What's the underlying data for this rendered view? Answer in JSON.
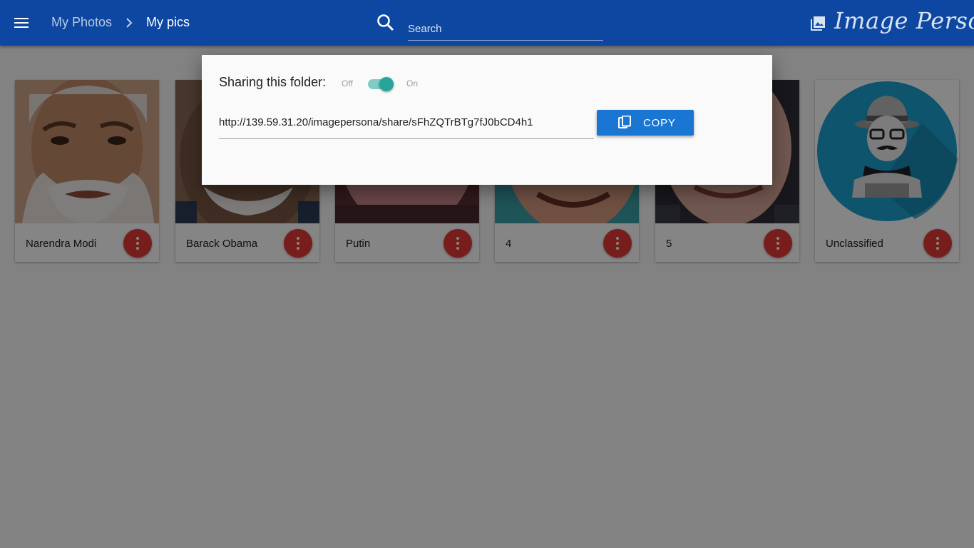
{
  "appbar": {
    "breadcrumb_root": "My Photos",
    "breadcrumb_current": "My pics",
    "search_placeholder": "Search",
    "brand": "Image Persona"
  },
  "cards": [
    {
      "label": "Narendra Modi"
    },
    {
      "label": "Barack Obama"
    },
    {
      "label": "Putin"
    },
    {
      "label": "4"
    },
    {
      "label": "5"
    },
    {
      "label": "Unclassified"
    }
  ],
  "dialog": {
    "title": "Sharing this folder:",
    "toggle_off_label": "Off",
    "toggle_on_label": "On",
    "sharing_enabled": true,
    "share_url": "http://139.59.31.20/imagepersona/share/sFhZQTrBTg7fJ0bCD4h1",
    "copy_label": "COPY"
  },
  "colors": {
    "appbar": "#0d47a1",
    "card_menu": "#e53935",
    "copy_button": "#1976d2",
    "toggle": "#26a69a"
  }
}
